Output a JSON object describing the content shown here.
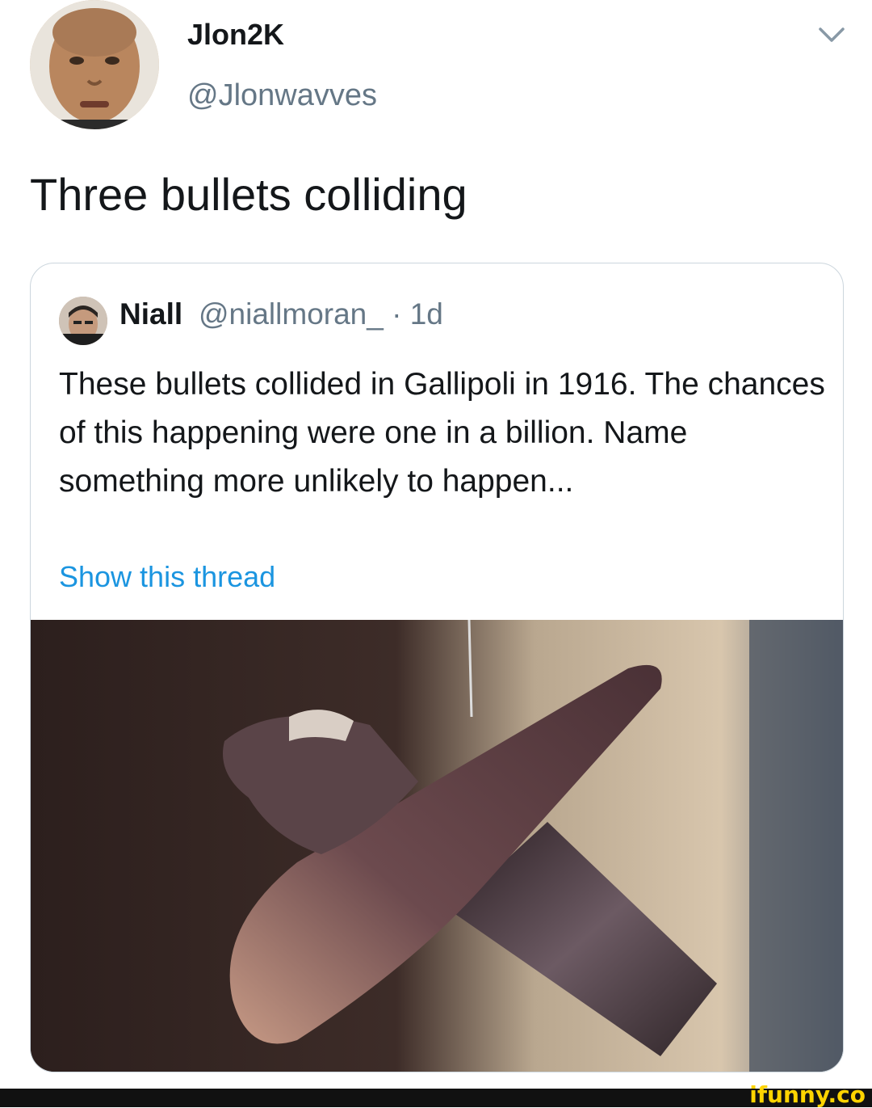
{
  "author": {
    "display_name": "Jlon2K",
    "handle": "@Jlonwavves"
  },
  "tweet": {
    "text": "Three bullets colliding"
  },
  "quoted_tweet": {
    "display_name": "Niall",
    "handle": "@niallmoran_",
    "separator": "·",
    "time": "1d",
    "text": "These bullets collided in Gallipoli in 1916. The chances of this happening were one in a billion. Name something more unlikely to happen...",
    "show_thread_label": "Show this thread"
  },
  "watermark": "ifunny.co",
  "icons": {
    "menu": "chevron-down-icon"
  },
  "colors": {
    "text": "#14171a",
    "muted": "#657786",
    "link": "#1b95e0",
    "border": "#ccd6dd"
  }
}
